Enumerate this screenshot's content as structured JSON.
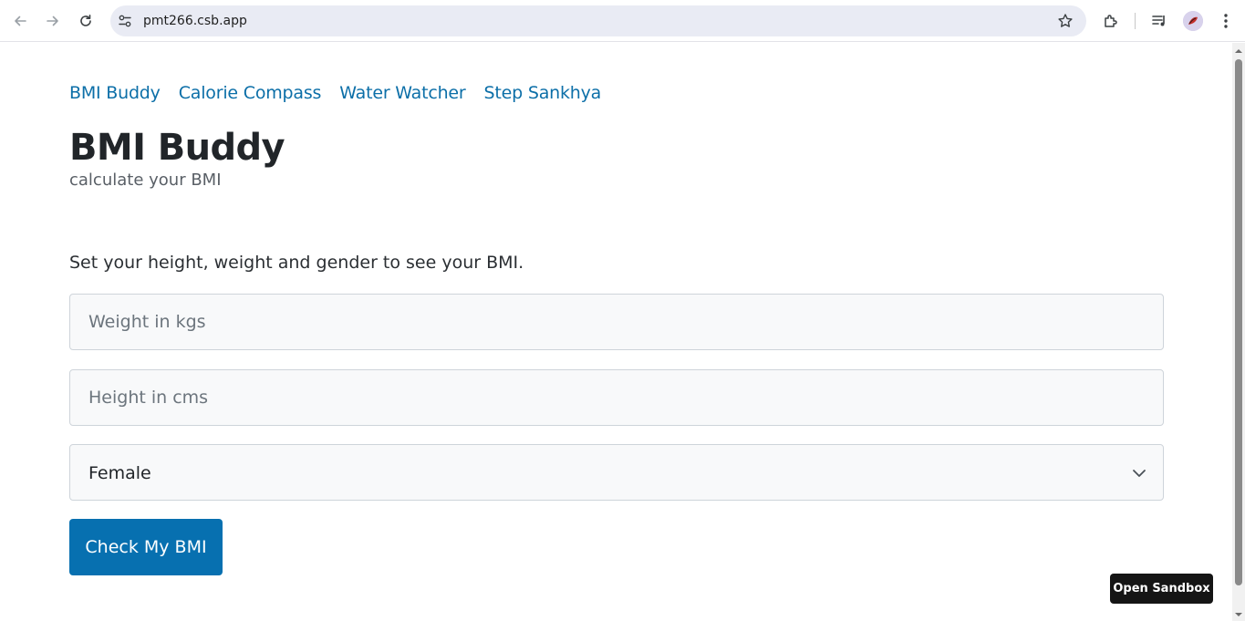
{
  "browser": {
    "url": "pmt266.csb.app",
    "icons": [
      "back-arrow-icon",
      "forward-arrow-icon",
      "reload-icon",
      "site-settings-icon",
      "bookmark-star-icon",
      "extensions-icon",
      "media-control-icon",
      "profile-avatar",
      "menu-kebab-icon"
    ]
  },
  "nav": {
    "links": [
      "BMI Buddy",
      "Calorie Compass",
      "Water Watcher",
      "Step Sankhya"
    ]
  },
  "header": {
    "title": "BMI Buddy",
    "subtitle": "calculate your BMI"
  },
  "form": {
    "instruction": "Set your height, weight and gender to see your BMI.",
    "weight_placeholder": "Weight in kgs",
    "height_placeholder": "Height in cms",
    "gender_selected": "Female",
    "submit_label": "Check My BMI"
  },
  "sandbox": {
    "open_label": "Open Sandbox"
  },
  "colors": {
    "link": "#0c6fa8",
    "primary_button": "#0770b0",
    "sandbox_button": "#151515"
  }
}
